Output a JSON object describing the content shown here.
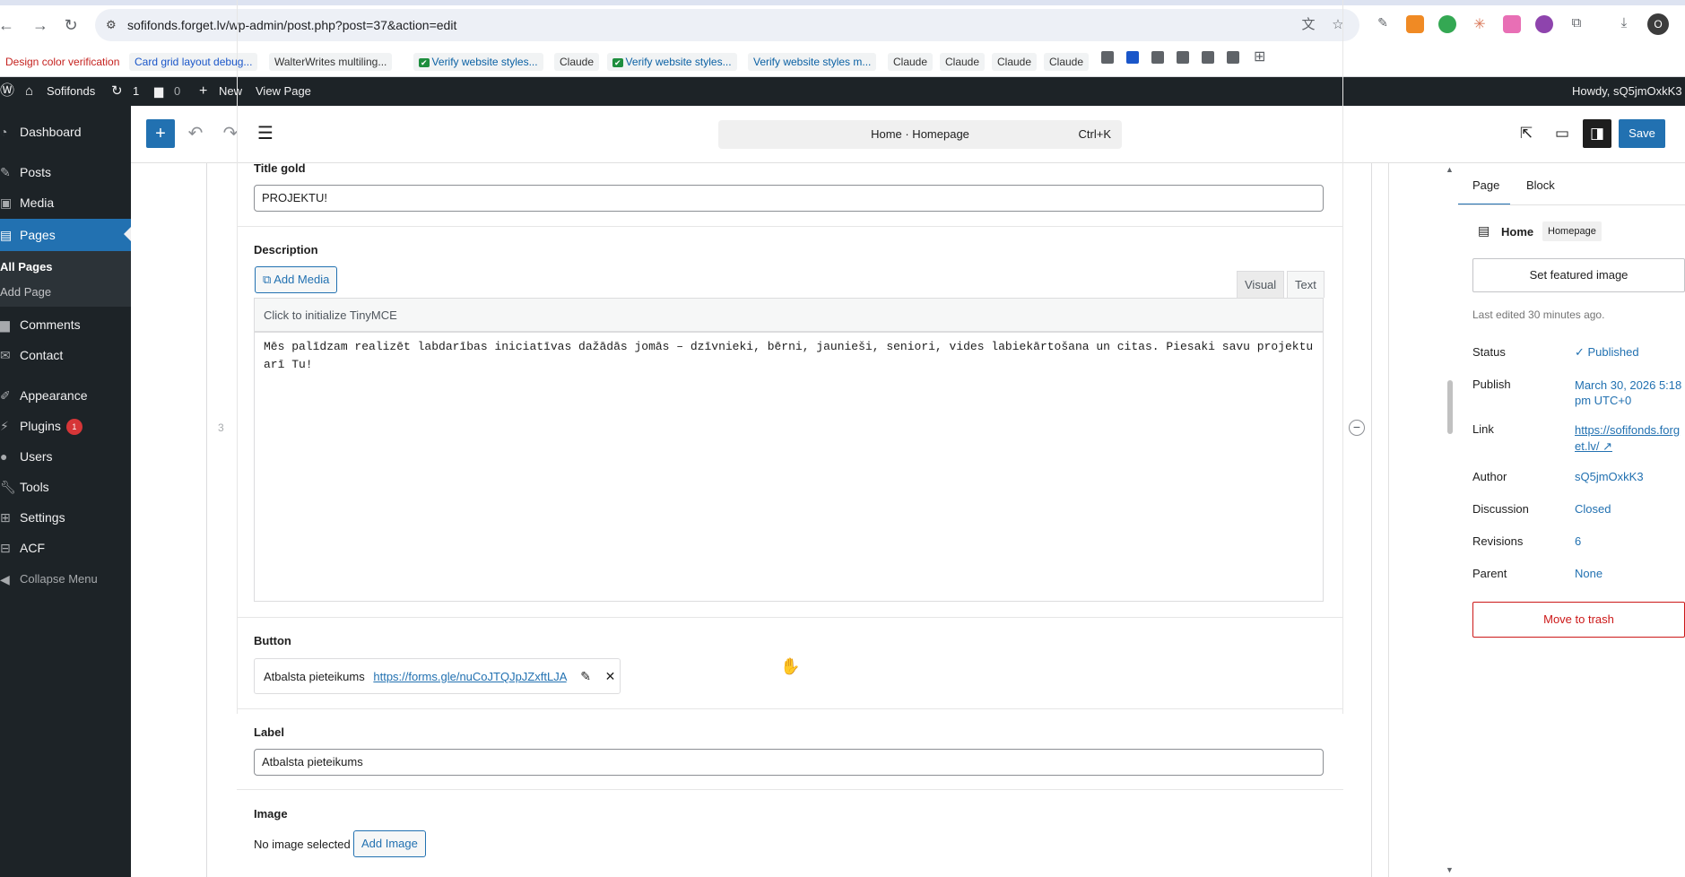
{
  "browser": {
    "url": "sofifonds.forget.lv/wp-admin/post.php?post=37&action=edit",
    "profile_initial": "O",
    "bookmarks": [
      "Design color verification",
      "Card grid layout debug...",
      "WalterWrites multiling...",
      "Verify website styles...",
      "Claude",
      "Verify website styles...",
      "Verify website styles m...",
      "Claude",
      "Claude",
      "Claude",
      "Claude"
    ]
  },
  "adminbar": {
    "site_name": "Sofifonds",
    "updates_count": "1",
    "comments_count": "0",
    "new_label": "New",
    "view_label": "View Page",
    "howdy": "Howdy, sQ5jmOxkK3"
  },
  "sidebar": {
    "items": [
      {
        "label": "Dashboard",
        "icon": "dashboard-icon"
      },
      {
        "label": "Posts",
        "icon": "pin-icon"
      },
      {
        "label": "Media",
        "icon": "media-icon"
      },
      {
        "label": "Pages",
        "icon": "pages-icon"
      },
      {
        "label": "Comments",
        "icon": "comment-icon"
      },
      {
        "label": "Contact",
        "icon": "mail-icon"
      },
      {
        "label": "Appearance",
        "icon": "brush-icon"
      },
      {
        "label": "Plugins",
        "icon": "plug-icon",
        "badge": "1"
      },
      {
        "label": "Users",
        "icon": "user-icon"
      },
      {
        "label": "Tools",
        "icon": "wrench-icon"
      },
      {
        "label": "Settings",
        "icon": "settings-icon"
      },
      {
        "label": "ACF",
        "icon": "acf-icon"
      },
      {
        "label": "Collapse Menu",
        "icon": "collapse-icon"
      }
    ],
    "submenu": [
      "All Pages",
      "Add Page"
    ]
  },
  "editor": {
    "doc_title": "Home · Homepage",
    "shortcut": "Ctrl+K",
    "save_label": "Save"
  },
  "fields": {
    "title_gold": {
      "label": "Title gold",
      "value": "PROJEKTU!"
    },
    "description": {
      "label": "Description",
      "add_media": "Add Media",
      "tab_visual": "Visual",
      "tab_text": "Text",
      "tinymce_hint": "Click to initialize TinyMCE",
      "content": "Mēs palīdzam realizēt labdarības iniciatīvas dažādās jomās – dzīvnieki, bērni, jaunieši, seniori, vides labiekārtošana un citas. Piesaki savu projektu arī Tu!"
    },
    "row_number": "3",
    "button": {
      "label": "Button",
      "link_text": "Atbalsta pieteikums",
      "link_url": "https://forms.gle/nuCoJTQJpJZxftLJA"
    },
    "label_field": {
      "label": "Label",
      "value": "Atbalsta pieteikums"
    },
    "image": {
      "label": "Image",
      "empty_text": "No image selected",
      "add_button": "Add Image"
    }
  },
  "inspector": {
    "tab_page": "Page",
    "tab_block": "Block",
    "page_name": "Home",
    "template_pill": "Homepage",
    "featured_image": "Set featured image",
    "last_edited": "Last edited 30 minutes ago.",
    "rows": [
      {
        "label": "Status",
        "value": "Published"
      },
      {
        "label": "Publish",
        "value": "March 30, 2026 5:18 pm UTC+0"
      },
      {
        "label": "Link",
        "value": "https://sofifonds.forget.lv/ ↗"
      },
      {
        "label": "Author",
        "value": "sQ5jmOxkK3"
      },
      {
        "label": "Discussion",
        "value": "Closed"
      },
      {
        "label": "Revisions",
        "value": "6"
      },
      {
        "label": "Parent",
        "value": "None"
      }
    ],
    "trash_label": "Move to trash"
  },
  "colors": {
    "wp_admin_dark": "#1d2327",
    "wp_blue": "#2271b1",
    "danger": "#cc1818"
  }
}
